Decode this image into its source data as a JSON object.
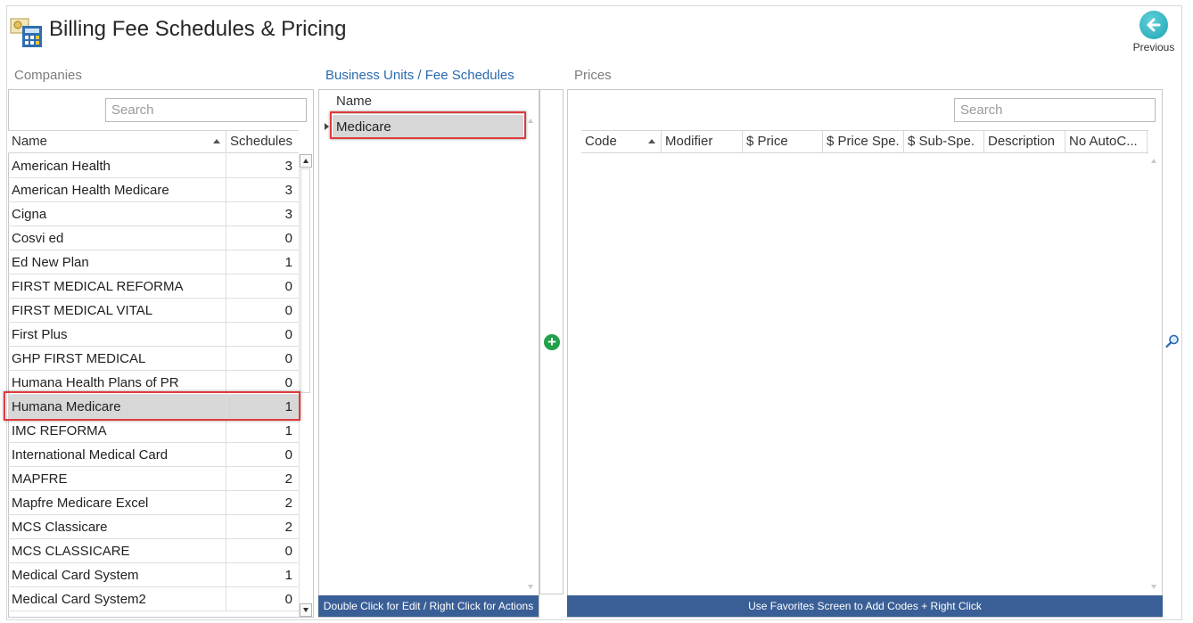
{
  "header": {
    "title": "Billing Fee Schedules & Pricing",
    "previous_label": "Previous"
  },
  "companies": {
    "title": "Companies",
    "search_placeholder": "Search",
    "columns": {
      "name": "Name",
      "schedules": "Schedules"
    },
    "rows": [
      {
        "name": "American Health",
        "schedules": "3"
      },
      {
        "name": "American Health Medicare",
        "schedules": "3"
      },
      {
        "name": "Cigna",
        "schedules": "3"
      },
      {
        "name": "Cosvi ed",
        "schedules": "0"
      },
      {
        "name": "Ed New Plan",
        "schedules": "1"
      },
      {
        "name": "FIRST MEDICAL REFORMA",
        "schedules": "0"
      },
      {
        "name": "FIRST MEDICAL VITAL",
        "schedules": "0"
      },
      {
        "name": "First Plus",
        "schedules": "0"
      },
      {
        "name": "GHP FIRST MEDICAL",
        "schedules": "0"
      },
      {
        "name": "Humana Health Plans of PR",
        "schedules": "0"
      },
      {
        "name": "Humana Medicare",
        "schedules": "1"
      },
      {
        "name": "IMC REFORMA",
        "schedules": "1"
      },
      {
        "name": "International Medical Card",
        "schedules": "0"
      },
      {
        "name": "MAPFRE",
        "schedules": "2"
      },
      {
        "name": "Mapfre Medicare Excel",
        "schedules": "2"
      },
      {
        "name": "MCS Classicare",
        "schedules": "2"
      },
      {
        "name": "MCS CLASSICARE",
        "schedules": "0"
      },
      {
        "name": "Medical Card System",
        "schedules": "1"
      },
      {
        "name": "Medical Card System2",
        "schedules": "0"
      }
    ],
    "selected_index": 10
  },
  "business_units": {
    "title": "Business Units / Fee Schedules",
    "column_name": "Name",
    "rows": [
      {
        "name": "Medicare"
      }
    ],
    "footer": "Double Click for Edit / Right Click for Actions"
  },
  "prices": {
    "title": "Prices",
    "search_placeholder": "Search",
    "columns": {
      "code": "Code",
      "modifier": "Modifier",
      "price": "$ Price",
      "price_spe": "$ Price Spe.",
      "sub_spe": "$ Sub-Spe.",
      "description": "Description",
      "no_autoc": "No AutoC..."
    },
    "footer": "Use Favorites Screen to Add Codes + Right Click"
  },
  "icons": {
    "app": "fee-schedule-calculator-icon",
    "previous": "arrow-left-icon",
    "add": "plus-circle-icon",
    "zoom": "magnifier-icon"
  },
  "colors": {
    "accent": "#2a6ab0",
    "footer_bar": "#3a5f97",
    "highlight": "#e03a3a",
    "add_green": "#23a04a",
    "previous_teal": "#1fa4b4"
  }
}
